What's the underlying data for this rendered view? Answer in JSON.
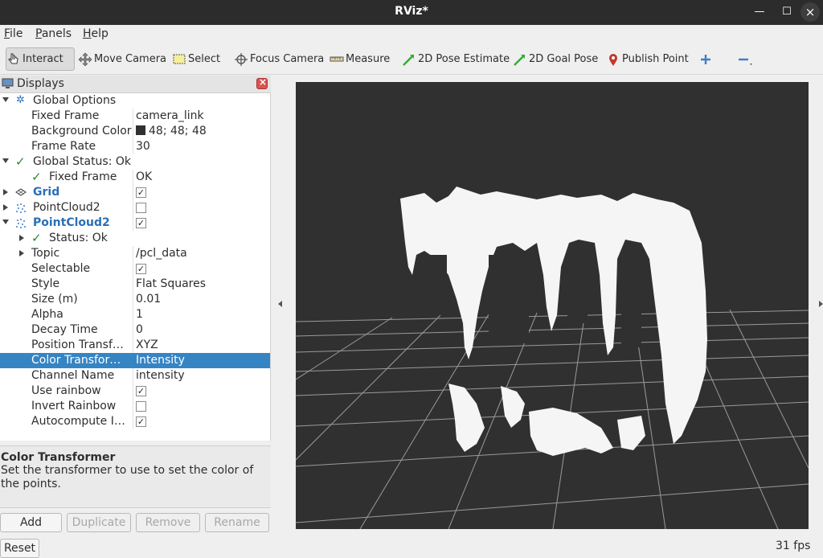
{
  "window": {
    "title": "RViz*"
  },
  "menu": [
    {
      "label": "File",
      "accel": "F",
      "rest": "ile"
    },
    {
      "label": "Panels",
      "accel": "P",
      "rest": "anels"
    },
    {
      "label": "Help",
      "accel": "H",
      "rest": "elp"
    }
  ],
  "toolbar": {
    "interact": "Interact",
    "move_camera": "Move Camera",
    "select": "Select",
    "focus_camera": "Focus Camera",
    "measure": "Measure",
    "pose_estimate": "2D Pose Estimate",
    "goal_pose": "2D Goal Pose",
    "publish_point": "Publish Point"
  },
  "displays": {
    "title": "Displays",
    "rows": {
      "global_options": "Global Options",
      "fixed_frame_k": "Fixed Frame",
      "fixed_frame_v": "camera_link",
      "bg_color_k": "Background Color",
      "bg_color_v": "48; 48; 48",
      "frame_rate_k": "Frame Rate",
      "frame_rate_v": "30",
      "global_status": "Global Status: Ok",
      "gs_fixed_frame_k": "Fixed Frame",
      "gs_fixed_frame_v": "OK",
      "grid": "Grid",
      "pc2_a": "PointCloud2",
      "pc2_b": "PointCloud2",
      "status_ok": "Status: Ok",
      "topic_k": "Topic",
      "topic_v": "/pcl_data",
      "selectable_k": "Selectable",
      "style_k": "Style",
      "style_v": "Flat Squares",
      "size_k": "Size (m)",
      "size_v": "0.01",
      "alpha_k": "Alpha",
      "alpha_v": "1",
      "decay_k": "Decay Time",
      "decay_v": "0",
      "position_k": "Position Transf…",
      "position_v": "XYZ",
      "color_k": "Color Transfor…",
      "color_v": "Intensity",
      "channel_k": "Channel Name",
      "channel_v": "intensity",
      "use_rainbow_k": "Use rainbow",
      "invert_rainbow_k": "Invert Rainbow",
      "autocompute_k": "Autocompute I…"
    },
    "checks": {
      "grid": true,
      "pc2_a": false,
      "pc2_b": true,
      "selectable": true,
      "use_rainbow": true,
      "invert_rainbow": false,
      "autocompute": true
    },
    "check_glyph": "✓"
  },
  "description": {
    "title": "Color Transformer",
    "text": "Set the transformer to use to set the color of the points."
  },
  "buttons": {
    "add": "Add",
    "duplicate": "Duplicate",
    "remove": "Remove",
    "rename": "Rename",
    "reset": "Reset"
  },
  "status": {
    "fps": "31 fps"
  },
  "colors": {
    "background": "#303030",
    "accent": "#3584c4",
    "ok": "#2a8a2a"
  }
}
